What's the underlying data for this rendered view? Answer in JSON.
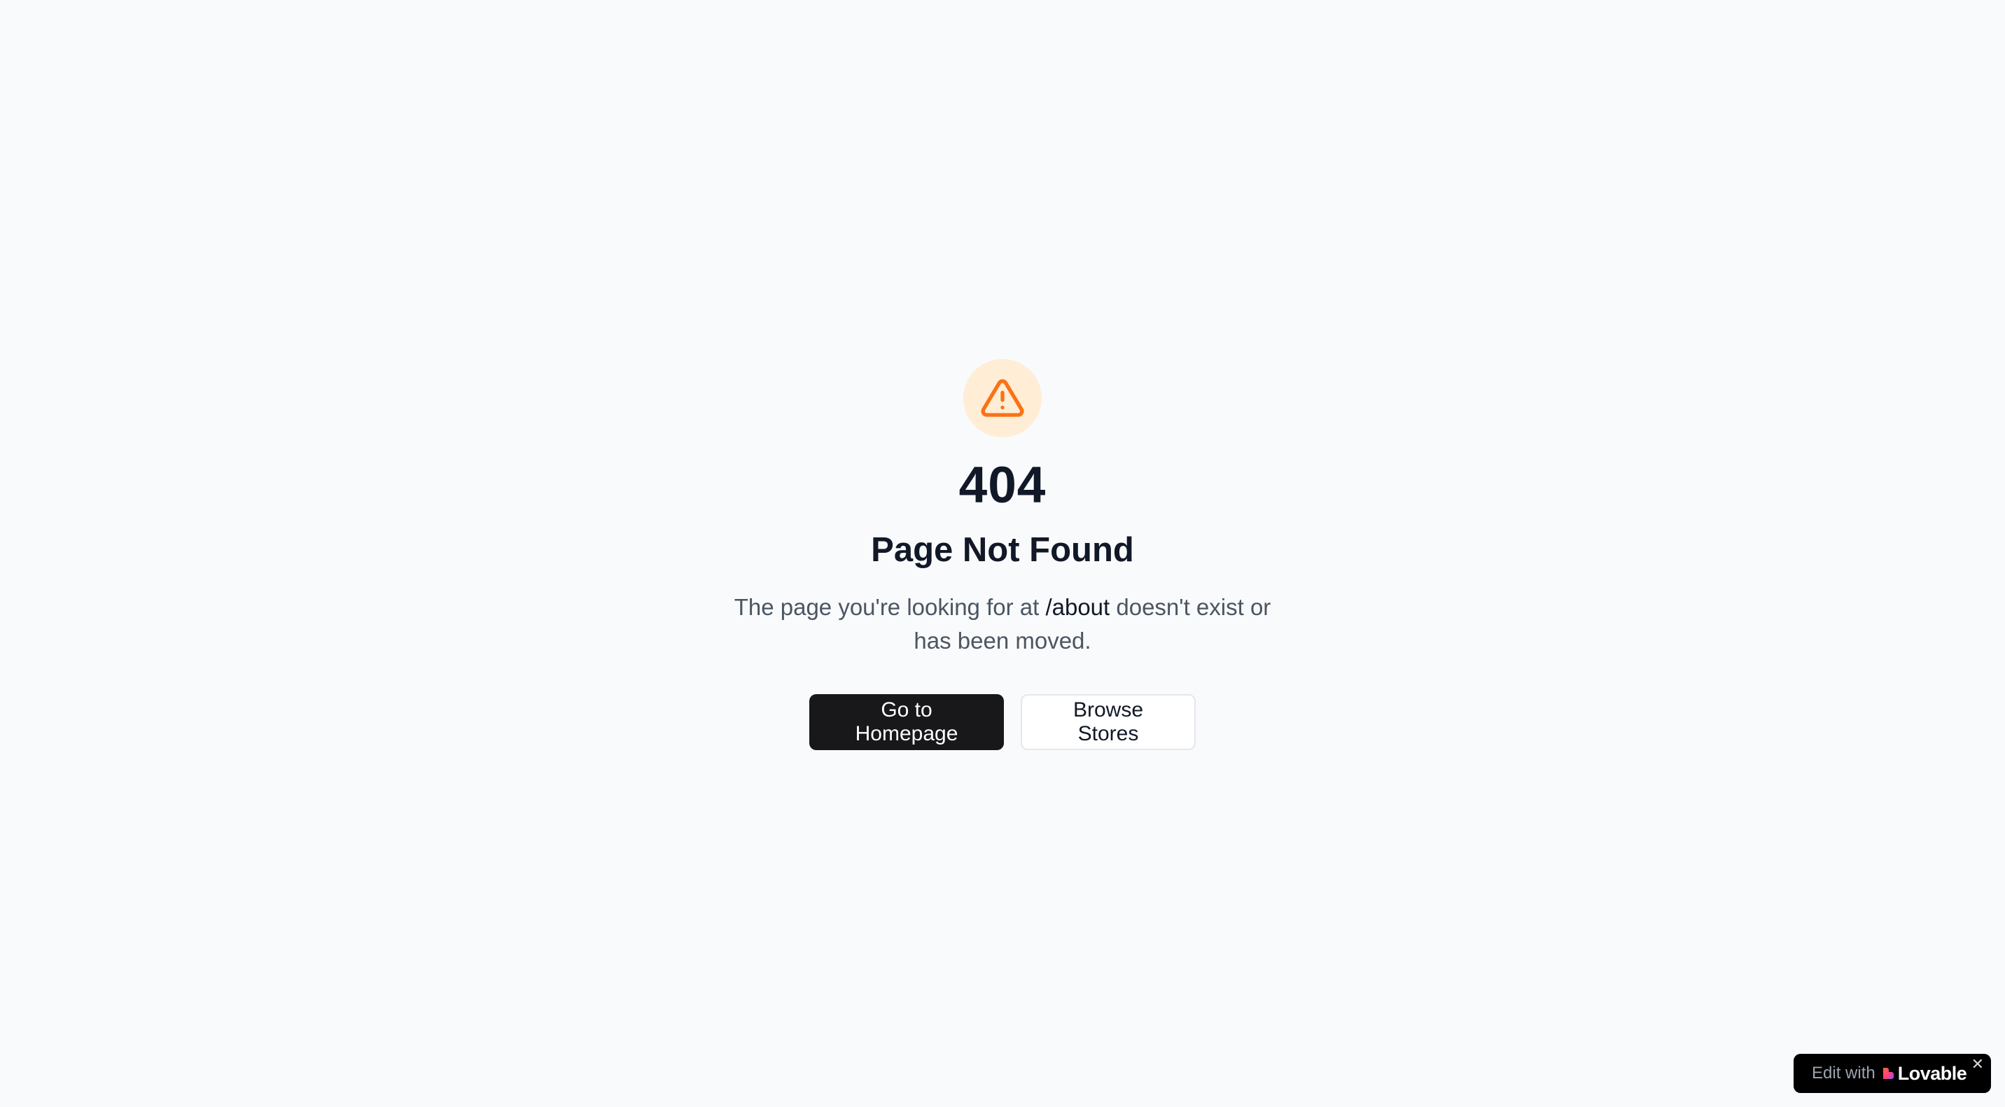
{
  "error": {
    "code": "404",
    "title": "Page Not Found",
    "description_before": "The page you're looking for at ",
    "path": "/about",
    "description_after": " doesn't exist or has been moved.",
    "icon": "warning-triangle-icon",
    "accent_color": "#f97316",
    "icon_bg_color": "#ffedd5"
  },
  "actions": {
    "homepage_label": "Go to Homepage",
    "browse_label": "Browse Stores"
  },
  "badge": {
    "edit_label": "Edit with",
    "brand_label": "Lovable",
    "close_label": "✕"
  }
}
